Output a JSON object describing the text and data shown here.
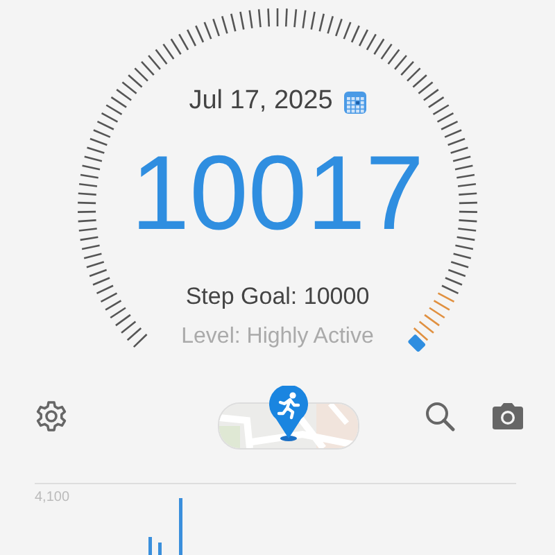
{
  "date": "Jul 17, 2025",
  "steps": "10017",
  "step_goal": "Step Goal: 10000",
  "level_label": "Level: Highly Active",
  "chart": {
    "top_label": "4,100"
  }
}
